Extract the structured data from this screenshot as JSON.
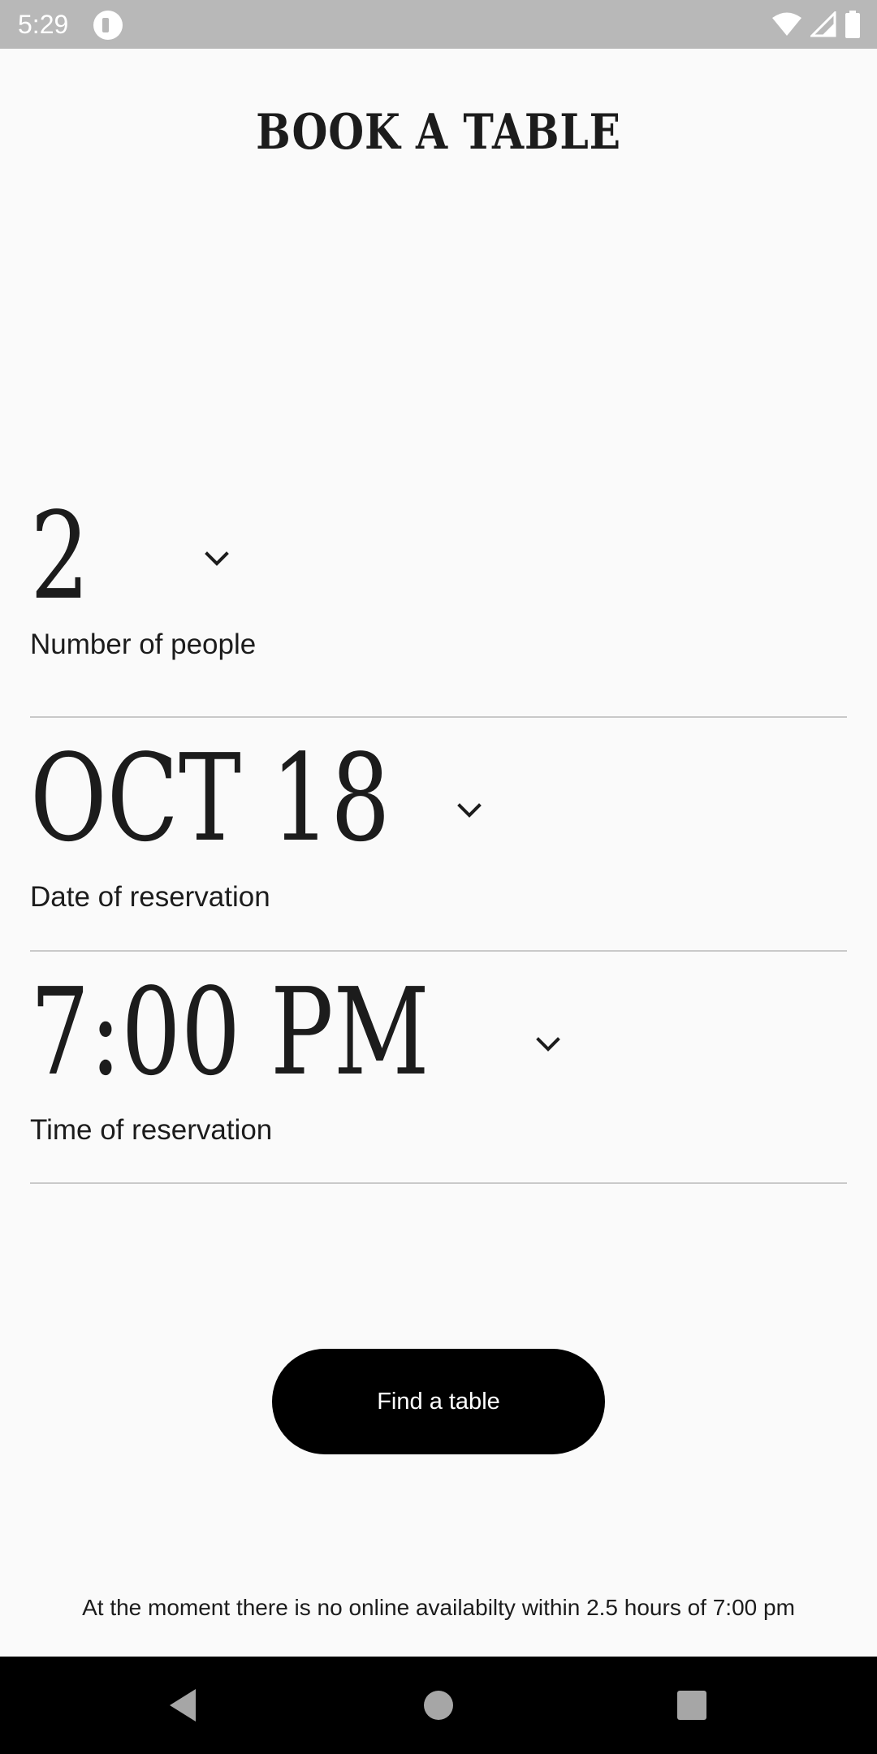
{
  "status_bar": {
    "time": "5:29",
    "app_icon": "app-logo-icon",
    "icons": [
      "wifi-icon",
      "cell-signal-icon",
      "battery-icon"
    ]
  },
  "header": {
    "title": "BOOK A TABLE"
  },
  "fields": {
    "people": {
      "value": "2",
      "label": "Number of people",
      "icon": "chevron-down-icon"
    },
    "date": {
      "value": "OCT 18",
      "label": "Date of reservation",
      "icon": "chevron-down-icon"
    },
    "time": {
      "value": "7:00 PM",
      "label": "Time of reservation",
      "icon": "chevron-down-icon"
    }
  },
  "actions": {
    "find_label": "Find a table"
  },
  "notice": {
    "text": "At the moment there is no online availabilty within 2.5 hours of 7:00 pm"
  },
  "nav_bar": {
    "icons": [
      "back-icon",
      "home-icon",
      "recents-icon"
    ]
  },
  "colors": {
    "background": "#fafafa",
    "status_bar": "#b8b8b8",
    "text": "#1c1c1c",
    "button": "#000000",
    "button_text": "#ffffff",
    "divider": "#c9c9c9",
    "nav_bar": "#000000"
  }
}
